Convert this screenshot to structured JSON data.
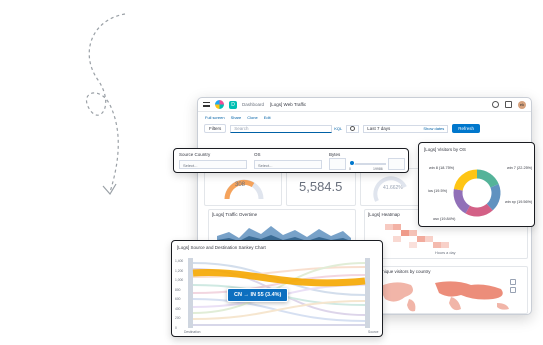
{
  "header": {
    "space_badge": "D",
    "breadcrumb_root": "Dashboard",
    "breadcrumb_current": "[Logs] Web Traffic",
    "avatar_initials": "ek"
  },
  "menu": [
    "Full screen",
    "Share",
    "Clone",
    "Edit"
  ],
  "query_bar": {
    "filters_label": "Filters",
    "search_placeholder": "Search",
    "kql_label": "KQL",
    "date_range": "Last 7 days",
    "show_dates": "Show dates",
    "refresh_label": "Refresh"
  },
  "controls": {
    "source_country_label": "Source Country",
    "source_country_placeholder": "Select...",
    "os_label": "OS",
    "os_placeholder": "Select...",
    "bytes_label": "Bytes",
    "bytes_min_tick": "0",
    "bytes_max_tick": "19986"
  },
  "metrics": {
    "gauge_value": "308",
    "big_number": "5,584.5",
    "percent_value": "41.662%"
  },
  "panels": {
    "traffic_title": "[Logs] Traffic Overtime",
    "heatmap_title": "[Logs] Heatmap",
    "heatmap_axis": "Hours a day",
    "map_title": "Unique visitors by country"
  },
  "os_chart": {
    "title": "[Logs] Visitors by OS",
    "slices": [
      {
        "label": "win 8 (18.75%)",
        "value": 18.75,
        "color": "#54b399"
      },
      {
        "label": "ios (19.5%)",
        "value": 19.5,
        "color": "#6092c0"
      },
      {
        "label": "osx (19.84%)",
        "value": 19.84,
        "color": "#d36086"
      },
      {
        "label": "win xp (19.56%)",
        "value": 19.56,
        "color": "#9170b8"
      },
      {
        "label": "win 7 (22.25%)",
        "value": 22.25,
        "color": "#fec514"
      }
    ]
  },
  "sankey": {
    "title": "[Logs] Source and Destination Sankey Chart",
    "y_ticks": [
      "1,400",
      "1,200",
      "1,000",
      "800",
      "600",
      "400",
      "200",
      "0"
    ],
    "left_axis_label": "Destination",
    "right_axis_label": "Source",
    "tooltip": "CN → IN 55 (3.4%)"
  }
}
